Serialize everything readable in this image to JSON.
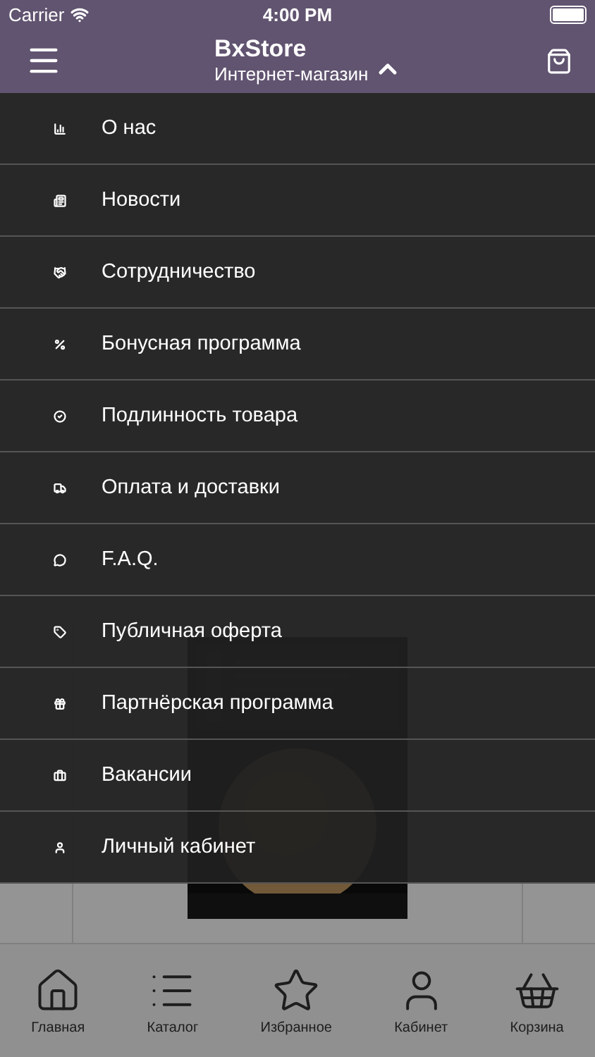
{
  "status_bar": {
    "carrier": "Carrier",
    "time": "4:00 PM"
  },
  "nav_bar": {
    "title": "BxStore",
    "subtitle": "Интернет-магазин"
  },
  "menu": {
    "items": [
      {
        "label": "О нас"
      },
      {
        "label": "Новости"
      },
      {
        "label": "Сотрудничество"
      },
      {
        "label": "Бонусная программа"
      },
      {
        "label": "Подлинность товара"
      },
      {
        "label": "Оплата и доставки"
      },
      {
        "label": "F.A.Q."
      },
      {
        "label": "Публичная оферта"
      },
      {
        "label": "Партнёрская программа"
      },
      {
        "label": "Вакансии"
      },
      {
        "label": "Личный кабинет"
      }
    ]
  },
  "tab_bar": [
    {
      "label": "Главная",
      "selected": false
    },
    {
      "label": "Каталог",
      "selected": false
    },
    {
      "label": "Избранное",
      "selected": false
    },
    {
      "label": "Кабинет",
      "selected": false
    },
    {
      "label": "Корзина",
      "selected": false
    }
  ]
}
